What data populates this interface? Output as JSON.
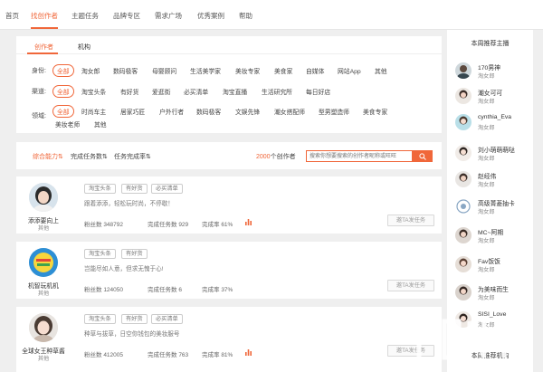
{
  "nav": {
    "items": [
      "首页",
      "找创作者",
      "主题任务",
      "品牌专区",
      "需求广场",
      "优秀案例",
      "帮助"
    ],
    "active_index": 1
  },
  "filter": {
    "tabs": [
      "创作者",
      "机构"
    ],
    "identity": {
      "label": "身份:",
      "options": [
        "全部",
        "淘女郎",
        "数码极客",
        "母婴顾问",
        "生活美学家",
        "美妆专家",
        "美食家",
        "自媒体",
        "网站App",
        "其他"
      ]
    },
    "channel": {
      "label": "渠道:",
      "options": [
        "全部",
        "淘宝头条",
        "有好货",
        "爱逛街",
        "必买清单",
        "淘宝直播",
        "生活研究所",
        "每日好店"
      ]
    },
    "domain": {
      "label": "领域:",
      "options": [
        "全部",
        "时尚车主",
        "居家巧匠",
        "户外行者",
        "数码极客",
        "文娱先锋",
        "潮女搭配师",
        "型男塑造师",
        "美食专家",
        "美妆老师",
        "其他"
      ]
    }
  },
  "sort": {
    "items": [
      "综合能力⇅",
      "完成任务数⇅",
      "任务完成率⇅"
    ],
    "count_number": "2000",
    "count_suffix": "个创作者",
    "search_placeholder": "搜索你想要搜索的创作者昵称或旺旺"
  },
  "creators": [
    {
      "name": "添添要向上",
      "field": "其他",
      "tags": [
        "淘宝头条",
        "有好货",
        "必买清单"
      ],
      "desc": "跟着添添，轻松玩时尚，不停歇！",
      "fans_label": "粉丝数",
      "fans": "348792",
      "tasks_label": "完成任务数",
      "tasks": "929",
      "rate_label": "完成率",
      "rate": "61%",
      "invite": "邀TA发任务"
    },
    {
      "name": "机智玩机机",
      "field": "其他",
      "tags": [
        "淘宝头条",
        "有好货"
      ],
      "desc": "岂能尽如人意，但求无愧于心!",
      "fans_label": "粉丝数",
      "fans": "124050",
      "tasks_label": "完成任务数",
      "tasks": "6",
      "rate_label": "完成率",
      "rate": "37%",
      "invite": "邀TA发任务"
    },
    {
      "name": "全球女王种草酱",
      "field": "其他",
      "tags": [
        "淘宝头条",
        "有好货",
        "必买清单"
      ],
      "desc": "种草与拔草，日空你钱包的美妆服号",
      "fans_label": "粉丝数",
      "fans": "412005",
      "tasks_label": "完成任务数",
      "tasks": "763",
      "rate_label": "完成率",
      "rate": "81%",
      "invite": "邀TA发任务"
    }
  ],
  "sidebar": {
    "title": "本周推荐主播",
    "bottom_title": "本周推荐机构",
    "items": [
      {
        "name": "170男神",
        "field": "淘女郎"
      },
      {
        "name": "潮女可可",
        "field": "淘女郎"
      },
      {
        "name": "cynthia_Eva",
        "field": "淘女郎"
      },
      {
        "name": "刘小萌萌萌哒",
        "field": "淘女郎"
      },
      {
        "name": "赵经伟",
        "field": "淘女郎"
      },
      {
        "name": "高级菁菱抽卡",
        "field": "淘女郎"
      },
      {
        "name": "MC~阿期",
        "field": "淘女郎"
      },
      {
        "name": "Fav饭饭",
        "field": "淘女郎"
      },
      {
        "name": "为美味而生",
        "field": "淘女郎"
      },
      {
        "name": "SISI_Love",
        "field": "淘女郎"
      }
    ]
  },
  "colors": {
    "accent": "#f0673a",
    "background": "#efefef"
  }
}
